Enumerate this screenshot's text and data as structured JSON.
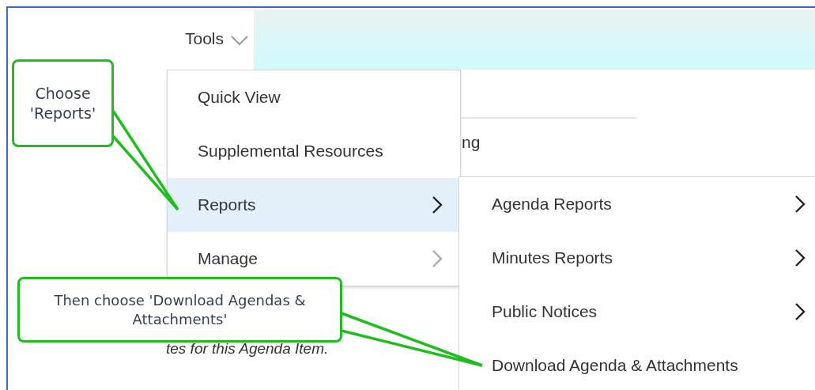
{
  "toolbar": {
    "menu_label": "Tools",
    "expanded": true
  },
  "page_fragments": {
    "heading_tail": "ng",
    "note_tail": "tes for this Agenda Item."
  },
  "menu": {
    "items": [
      {
        "label": "Quick View",
        "selected": false,
        "has_submenu": false
      },
      {
        "label": "Supplemental Resources",
        "selected": false,
        "has_submenu": false
      },
      {
        "label": "Reports",
        "selected": true,
        "has_submenu": true
      },
      {
        "label": "Manage",
        "selected": false,
        "has_submenu": true
      }
    ]
  },
  "submenu": {
    "items": [
      {
        "label": "Agenda Reports",
        "has_submenu": true
      },
      {
        "label": "Minutes Reports",
        "has_submenu": true
      },
      {
        "label": "Public Notices",
        "has_submenu": true
      },
      {
        "label": "Download Agenda & Attachments",
        "has_submenu": false
      }
    ]
  },
  "callouts": [
    {
      "text": "Choose 'Reports'"
    },
    {
      "text": "Then choose 'Download Agendas & Attachments'"
    }
  ]
}
